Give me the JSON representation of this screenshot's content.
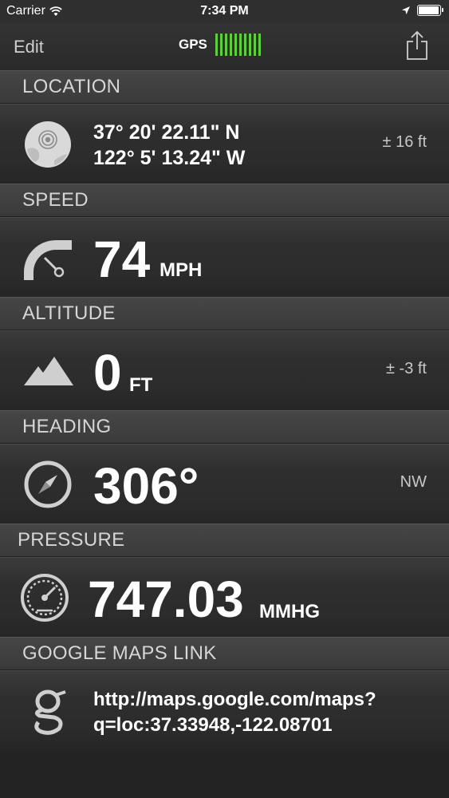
{
  "status_bar": {
    "carrier": "Carrier",
    "time": "7:34 PM"
  },
  "nav": {
    "edit_label": "Edit",
    "gps_label": "GPS",
    "gps_signal_bars": 10,
    "gps_bar_color": "#5ccf3a"
  },
  "sections": {
    "location": {
      "header": "LOCATION",
      "latitude": "37° 20' 22.11\" N",
      "longitude": "122° 5' 13.24\" W",
      "accuracy": "± 16 ft",
      "icon": "globe-icon"
    },
    "speed": {
      "header": "SPEED",
      "value": "74",
      "unit": "MPH",
      "icon": "speedometer-icon"
    },
    "altitude": {
      "header": "ALTITUDE",
      "value": "0",
      "unit": "FT",
      "accuracy": "± -3 ft",
      "icon": "mountain-icon"
    },
    "heading": {
      "header": "HEADING",
      "value": "306°",
      "direction": "NW",
      "icon": "compass-icon"
    },
    "pressure": {
      "header": "PRESSURE",
      "value": "747.03",
      "unit": "MMHG",
      "icon": "barometer-icon"
    },
    "maps": {
      "header": "GOOGLE MAPS LINK",
      "url_line1": "http://maps.google.com/maps?",
      "url_line2": "q=loc:37.33948,-122.08701",
      "icon": "google-icon"
    }
  }
}
